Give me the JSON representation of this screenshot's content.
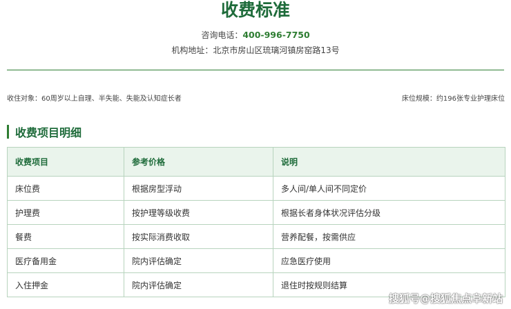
{
  "header": {
    "title": "收费标准",
    "phone_label": "咨询电话：",
    "phone_number": "400-996-7750",
    "address_label": "机构地址：",
    "address_value": "北京市房山区琉璃河镇房窑路13号"
  },
  "info": {
    "target_label": "收住对象：",
    "target_value": "60周岁以上自理、半失能、失能及认知症长者",
    "beds_label": "床位规模：",
    "beds_value": "约196张专业护理床位"
  },
  "section": {
    "title": "收费项目明细"
  },
  "table": {
    "headers": [
      "收费项目",
      "参考价格",
      "说明"
    ],
    "rows": [
      [
        "床位费",
        "根据房型浮动",
        "多人间/单人间不同定价"
      ],
      [
        "护理费",
        "按护理等级收费",
        "根据长者身体状况评估分级"
      ],
      [
        "餐费",
        "按实际消费收取",
        "营养配餐，按需供应"
      ],
      [
        "医疗备用金",
        "院内评估确定",
        "应急医疗使用"
      ],
      [
        "入住押金",
        "院内评估确定",
        "退住时按规则结算"
      ]
    ]
  },
  "watermark": "搜狐号@搜狐焦点阜新站",
  "colors": {
    "accent": "#1e6b3a",
    "header_bg": "#eaf4ec",
    "border": "#b7d3bd"
  }
}
